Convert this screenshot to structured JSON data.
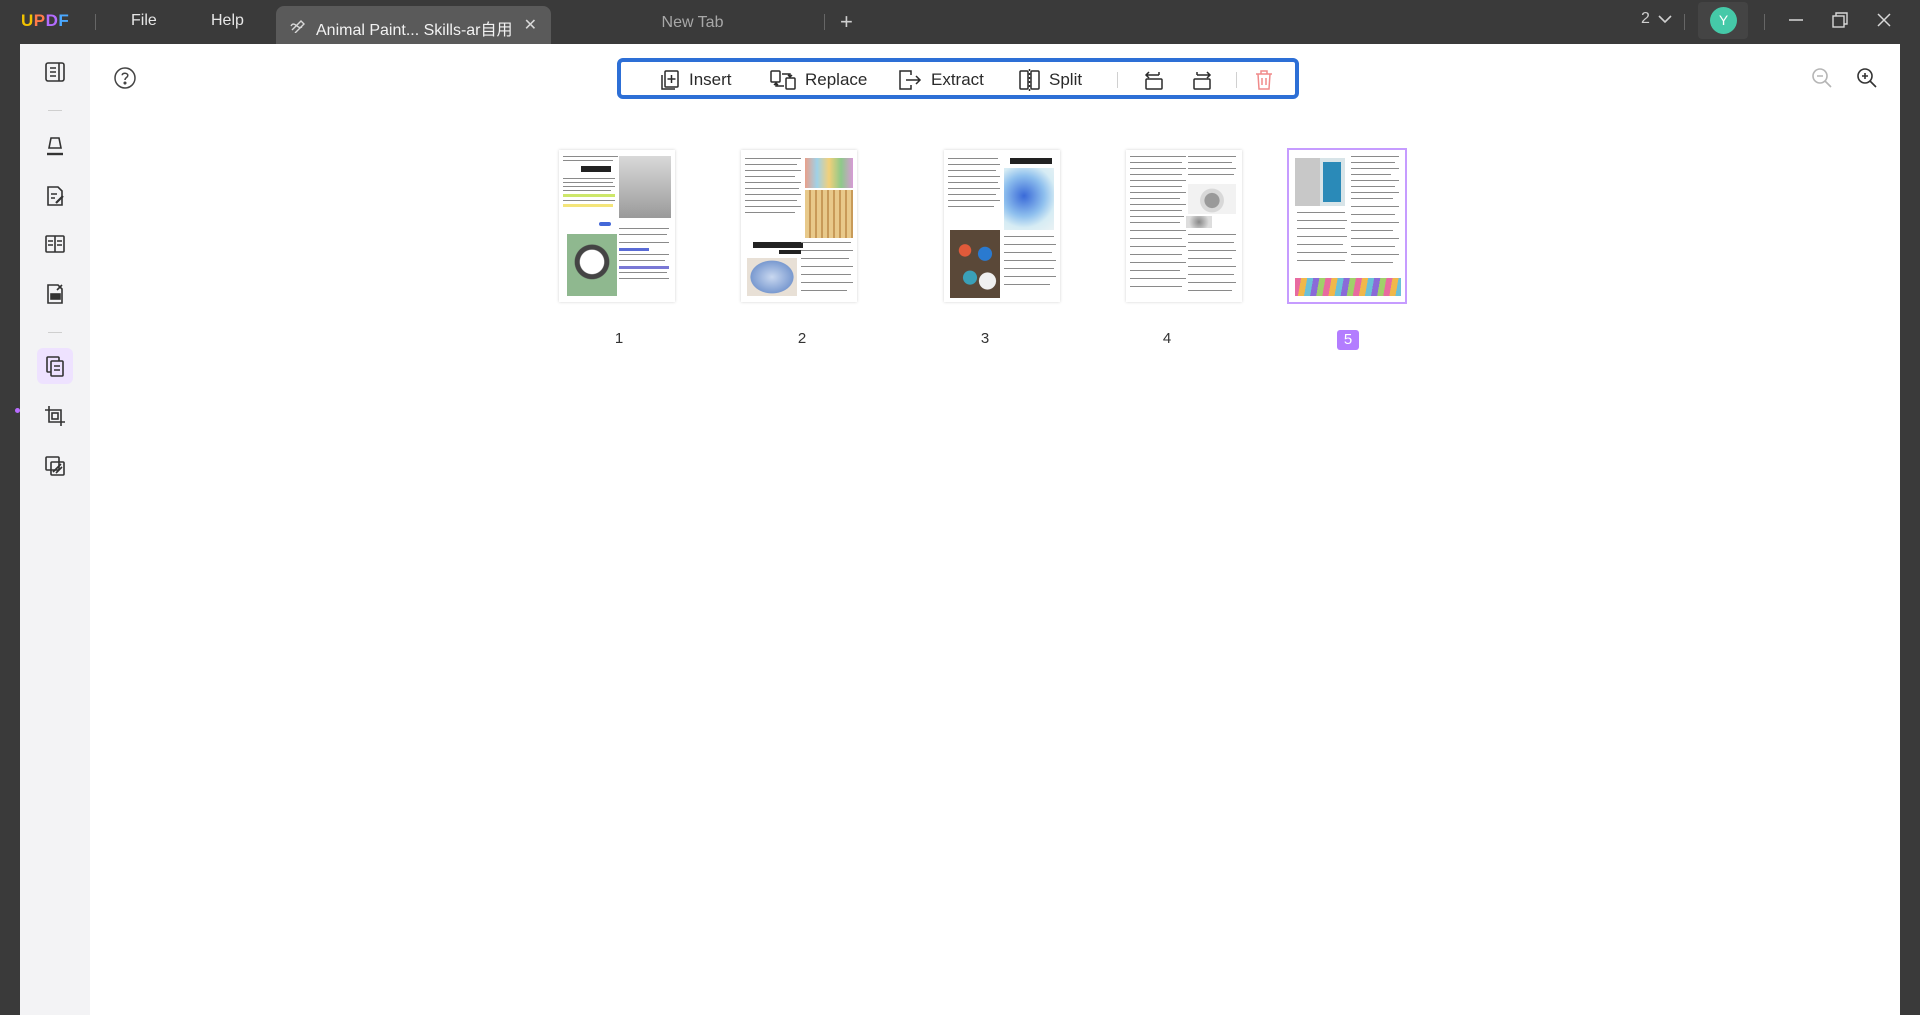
{
  "app": {
    "logo_letters": [
      "U",
      "P",
      "D",
      "F"
    ],
    "menu": {
      "file": "File",
      "help": "Help"
    },
    "tabs": [
      {
        "label": "Animal Paint... Skills-ar自用",
        "active": true
      },
      {
        "label": "New Tab",
        "active": false
      }
    ],
    "window_count": "2",
    "avatar_initial": "Y",
    "avatar_color": "#45c9a8"
  },
  "toolbar": {
    "insert": "Insert",
    "replace": "Replace",
    "extract": "Extract",
    "split": "Split",
    "highlight_color": "#2d6fd6"
  },
  "sidebar": {
    "items": [
      {
        "icon": "reader-icon",
        "active": false
      },
      {
        "icon": "comment-icon",
        "active": false
      },
      {
        "icon": "edit-pdf-icon",
        "active": false
      },
      {
        "icon": "form-icon",
        "active": false
      },
      {
        "icon": "redact-icon",
        "active": false
      },
      {
        "icon": "organize-pages-icon",
        "active": true
      },
      {
        "icon": "crop-icon",
        "active": false
      },
      {
        "icon": "combine-icon",
        "active": false
      }
    ],
    "accent": "#b37dff"
  },
  "pages": [
    {
      "number": "1",
      "selected": false
    },
    {
      "number": "2",
      "selected": false
    },
    {
      "number": "3",
      "selected": false
    },
    {
      "number": "4",
      "selected": false
    },
    {
      "number": "5",
      "selected": true
    }
  ]
}
